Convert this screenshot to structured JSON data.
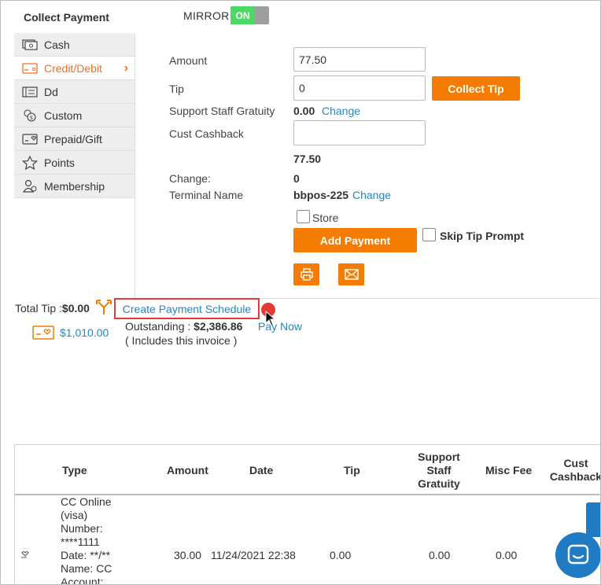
{
  "header": {
    "title": "Collect Payment",
    "mirror_label": "MIRROR",
    "toggle_state": "ON"
  },
  "sidebar": {
    "items": [
      {
        "label": "Cash",
        "icon": "cash-icon"
      },
      {
        "label": "Credit/Debit",
        "icon": "credit-card-icon",
        "active": true
      },
      {
        "label": "Dd",
        "icon": "check-icon"
      },
      {
        "label": "Custom",
        "icon": "coins-icon"
      },
      {
        "label": "Prepaid/Gift",
        "icon": "gift-card-icon"
      },
      {
        "label": "Points",
        "icon": "star-icon"
      },
      {
        "label": "Membership",
        "icon": "membership-icon"
      }
    ]
  },
  "form": {
    "amount_label": "Amount",
    "amount_value": "77.50",
    "tip_label": "Tip",
    "tip_value": "0",
    "collect_tip_label": "Collect Tip",
    "gratuity_label": "Support Staff Gratuity",
    "gratuity_value": "0.00",
    "gratuity_change": "Change",
    "cashback_label": "Cust Cashback",
    "cashback_value": "",
    "total_value": "77.50",
    "change_label": "Change:",
    "change_value": "0",
    "terminal_label": "Terminal Name",
    "terminal_value": "bbpos-225",
    "terminal_change": "Change",
    "store_label": "Store",
    "add_payment_label": "Add Payment",
    "skip_tip_label": "Skip Tip Prompt"
  },
  "summary": {
    "total_tip_label": "Total Tip :",
    "total_tip_value": "$0.00",
    "create_schedule_label": "Create Payment Schedule",
    "gift_amount": "$1,010.00",
    "outstanding_label": "Outstanding :",
    "outstanding_value": "$2,386.86",
    "includes_note": "( Includes this invoice )",
    "pay_now_label": "Pay Now"
  },
  "table": {
    "headers": {
      "type": "Type",
      "amount": "Amount",
      "date": "Date",
      "tip": "Tip",
      "support_staff_gratuity": "Support Staff Gratuity",
      "misc_fee": "Misc Fee",
      "cust_cashback": "Cust Cashback"
    },
    "rows": [
      {
        "type_lines": [
          "CC Online",
          "(visa)",
          "Number:",
          "****1111",
          "Date: **/**",
          "Name: CC",
          "Account:"
        ],
        "amount": "30.00",
        "date": "11/24/2021 22:38",
        "tip": "0.00",
        "gratuity": "0.00",
        "misc_fee": "0.00"
      }
    ]
  },
  "colors": {
    "accent": "#f57c00",
    "link": "#1e88c7",
    "toggle_on": "#4cd964",
    "highlight": "#e53935",
    "chat": "#1e7bc4"
  }
}
